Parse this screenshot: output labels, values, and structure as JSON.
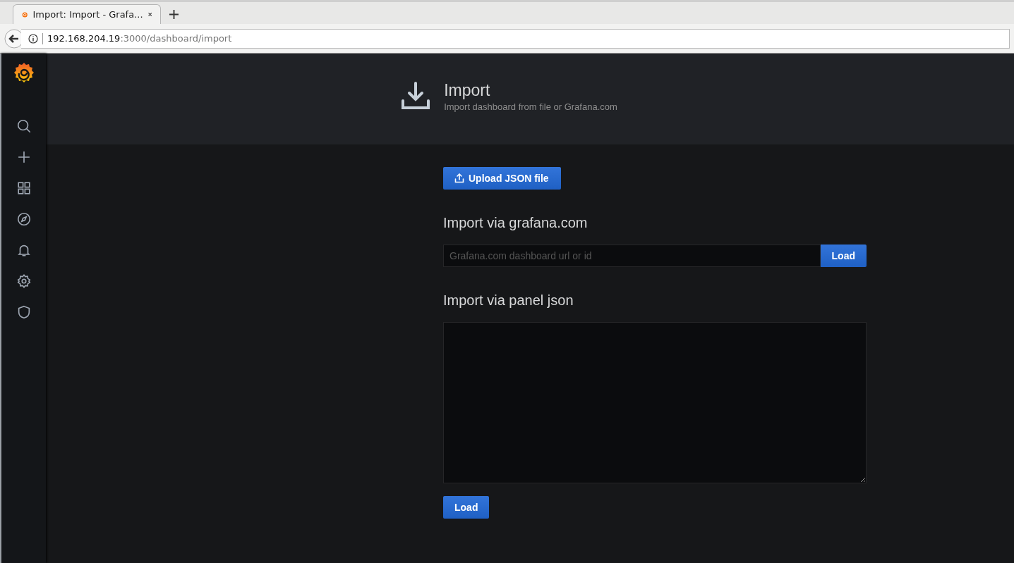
{
  "browser": {
    "tab_title": "Import: Import - Grafa...",
    "url_host": "192.168.204.19",
    "url_rest": ":3000/dashboard/import"
  },
  "header": {
    "title": "Import",
    "subtitle": "Import dashboard from file or Grafana.com"
  },
  "upload_button": "Upload JSON file",
  "grafana_com": {
    "heading": "Import via grafana.com",
    "placeholder": "Grafana.com dashboard url or id",
    "button": "Load"
  },
  "panel_json": {
    "heading": "Import via panel json",
    "button": "Load"
  }
}
